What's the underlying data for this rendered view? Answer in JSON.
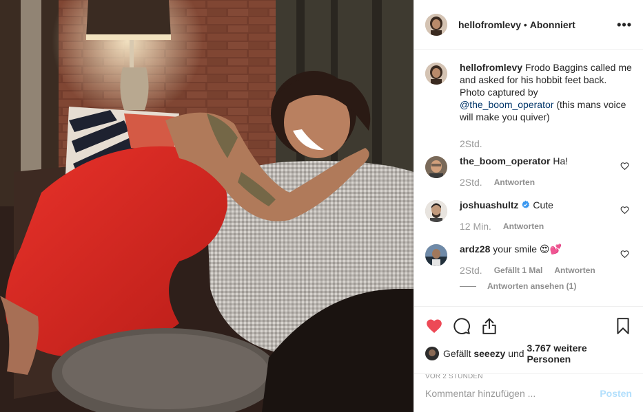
{
  "post": {
    "username": "hellofromlevy",
    "separator": "•",
    "follow_status": "Abonniert",
    "more_label": "•••"
  },
  "caption": {
    "username": "hellofromlevy",
    "text": "Frodo Baggins called me and asked for his hobbit feet back. Photo captured by",
    "mention": "@the_boom_operator",
    "text_after": "(this mans voice will make you quiver)",
    "time": "2Std."
  },
  "comments": [
    {
      "username": "the_boom_operator",
      "text": "Ha!",
      "time": "2Std.",
      "likes": "",
      "reply": "Antworten",
      "verified": false
    },
    {
      "username": "joshuashultz",
      "text": "Cute",
      "time": "12 Min.",
      "likes": "",
      "reply": "Antworten",
      "verified": true
    },
    {
      "username": "ardz28",
      "text": "your smile 😍💕",
      "time": "2Std.",
      "likes": "Gefällt 1 Mal",
      "reply": "Antworten",
      "verified": false
    }
  ],
  "view_replies": "Antworten ansehen (1)",
  "likes": {
    "prefix": "Gefällt",
    "user": "seeezy",
    "middle": "und",
    "count": "3.767 weitere Personen"
  },
  "timestamp": "VOR 2 STUNDEN",
  "add_comment": {
    "placeholder": "Kommentar hinzufügen ...",
    "post_label": "Posten"
  },
  "colors": {
    "like_red": "#ed4956",
    "link_blue": "#003569",
    "post_button": "#b2dffc"
  },
  "icons": [
    "heart-icon",
    "comment-icon",
    "share-icon",
    "bookmark-icon",
    "verified-icon",
    "small-heart-icon"
  ]
}
